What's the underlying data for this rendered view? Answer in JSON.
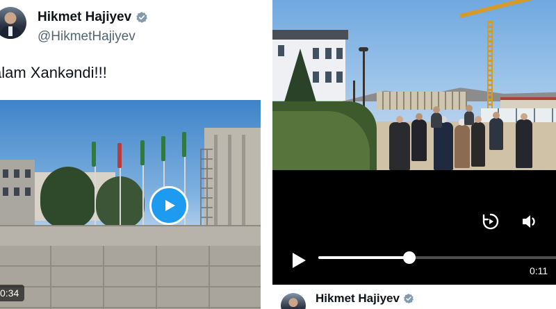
{
  "tweet": {
    "display_name": "Hikmet Hajiyev",
    "handle": "@HikmetHajiyev",
    "text": "alam Xankəndi!!!",
    "video_duration": "0:34"
  },
  "player": {
    "elapsed": "0:11",
    "progress_fraction": 0.38
  },
  "footer": {
    "display_name": "Hikmet Hajiyev"
  },
  "icons": {
    "verified": "verified-badge-icon",
    "play": "play-icon",
    "replay": "replay-icon",
    "volume": "volume-icon"
  },
  "colors": {
    "accent": "#1d9bf0",
    "text_primary": "#0f1419",
    "text_secondary": "#536471"
  }
}
